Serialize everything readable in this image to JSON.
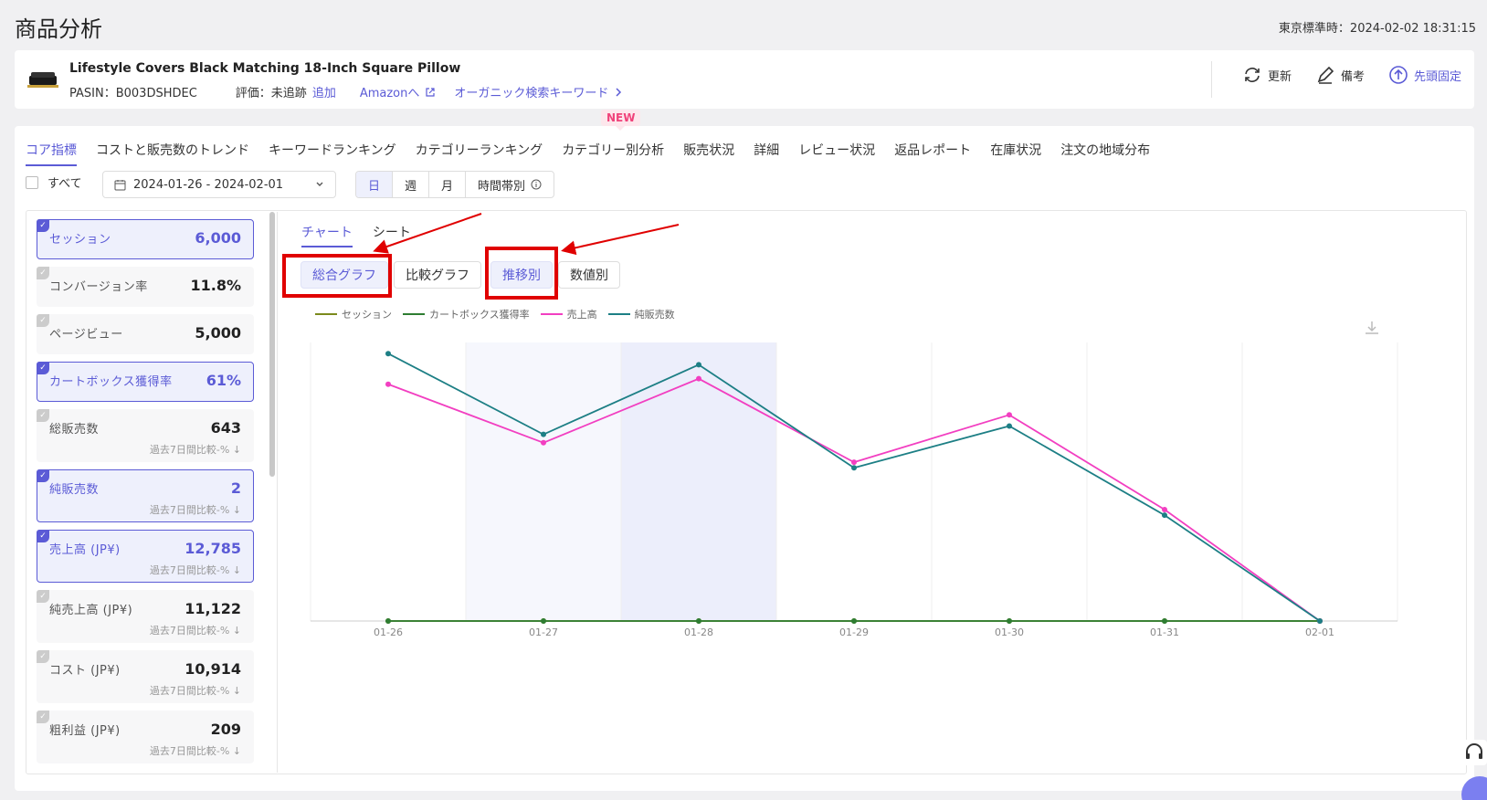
{
  "header": {
    "title": "商品分析",
    "timezone_label": "東京標準時：2024-02-02 18:31:15"
  },
  "product": {
    "name": "Lifestyle Covers Black Matching 18-Inch Square Pillow",
    "asin_label": "PASIN：B003DSHDEC",
    "rating_label": "評価：未追跡",
    "add_link": "追加",
    "amazon_link": "Amazonへ",
    "keyword_link": "オーガニック検索キーワード",
    "actions": {
      "refresh": "更新",
      "note": "備考",
      "pin": "先頭固定"
    }
  },
  "tabs": [
    "コア指標",
    "コストと販売数のトレンド",
    "キーワードランキング",
    "カテゴリーランキング",
    "カテゴリー別分析",
    "販売状況",
    "詳細",
    "レビュー状況",
    "返品レポート",
    "在庫状況",
    "注文の地域分布"
  ],
  "new_badge": "NEW",
  "filters": {
    "all_label": "すべて",
    "date_range": "2024-01-26 - 2024-02-01",
    "periods": [
      "日",
      "週",
      "月",
      "時間帯別"
    ]
  },
  "metrics": [
    {
      "label": "セッション",
      "value": "6,000",
      "selected": true,
      "compare": ""
    },
    {
      "label": "コンバージョン率",
      "value": "11.8%",
      "selected": false,
      "compare": ""
    },
    {
      "label": "ページビュー",
      "value": "5,000",
      "selected": false,
      "compare": ""
    },
    {
      "label": "カートボックス獲得率",
      "value": "61%",
      "selected": true,
      "compare": ""
    },
    {
      "label": "総販売数",
      "value": "643",
      "selected": false,
      "compare": "過去7日間比較-% ↓"
    },
    {
      "label": "純販売数",
      "value": "2",
      "selected": true,
      "compare": "過去7日間比較-% ↓"
    },
    {
      "label": "売上高 (JP¥)",
      "value": "12,785",
      "selected": true,
      "compare": "過去7日間比較-% ↓"
    },
    {
      "label": "純売上高 (JP¥)",
      "value": "11,122",
      "selected": false,
      "compare": "過去7日間比較-% ↓"
    },
    {
      "label": "コスト (JP¥)",
      "value": "10,914",
      "selected": false,
      "compare": "過去7日間比較-% ↓"
    },
    {
      "label": "粗利益 (JP¥)",
      "value": "209",
      "selected": false,
      "compare": "過去7日間比較-% ↓"
    }
  ],
  "chart_panel": {
    "subtabs": [
      "チャート",
      "シート"
    ],
    "mode_buttons": [
      "総合グラフ",
      "比較グラフ"
    ],
    "view_buttons": [
      "推移別",
      "数値別"
    ]
  },
  "colors": {
    "accent": "#5b5bd6",
    "highlight_red": "#e00000"
  },
  "chart_data": {
    "type": "line",
    "categories": [
      "01-26",
      "01-27",
      "01-28",
      "01-29",
      "01-30",
      "01-31",
      "02-01"
    ],
    "series": [
      {
        "name": "セッション",
        "color": "#7b8a1c",
        "values": [
          0,
          0,
          0,
          0,
          0,
          0,
          0
        ]
      },
      {
        "name": "カートボックス獲得率",
        "color": "#2e7d32",
        "values": [
          0,
          0,
          0,
          0,
          0,
          0,
          0
        ]
      },
      {
        "name": "売上高",
        "color": "#f23fc1",
        "values": [
          85,
          64,
          87,
          57,
          74,
          40,
          0
        ]
      },
      {
        "name": "純販売数",
        "color": "#1d7f85",
        "values": [
          96,
          67,
          92,
          55,
          70,
          38,
          0
        ]
      }
    ],
    "grid": true,
    "legend": "top-left"
  }
}
